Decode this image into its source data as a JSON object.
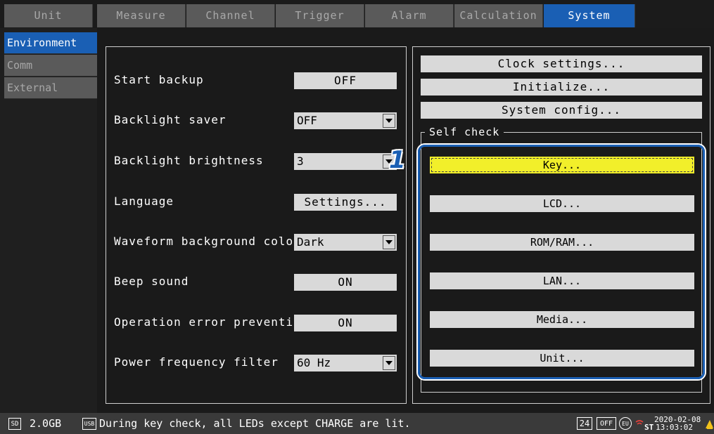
{
  "tabs": [
    "Unit",
    "Measure",
    "Channel",
    "Trigger",
    "Alarm",
    "Calculation",
    "System"
  ],
  "active_tab": "System",
  "left_menu": [
    "Environment",
    "Comm",
    "External"
  ],
  "settings": {
    "start_backup": {
      "label": "Start backup",
      "value": "OFF"
    },
    "backlight_saver": {
      "label": "Backlight saver",
      "value": "OFF"
    },
    "backlight_brightness": {
      "label": "Backlight brightness",
      "value": "3"
    },
    "language": {
      "label": "Language",
      "value": "Settings..."
    },
    "waveform_bg": {
      "label": "Waveform background color",
      "value": "Dark"
    },
    "beep": {
      "label": "Beep sound",
      "value": "ON"
    },
    "op_error": {
      "label": "Operation error prevention",
      "value": "ON"
    },
    "power_filter": {
      "label": "Power frequency filter",
      "value": "60 Hz"
    }
  },
  "system_buttons": {
    "clock": "Clock settings...",
    "initialize": "Initialize...",
    "config": "System config..."
  },
  "self_check": {
    "title": "Self check",
    "buttons": [
      "Key...",
      "LCD...",
      "ROM/RAM...",
      "LAN...",
      "Media...",
      "Unit..."
    ]
  },
  "step_marker": "1",
  "status": {
    "sd_icon": "SD",
    "capacity": "2.0GB",
    "usb_icon": "USB",
    "message": "During key check, all LEDs except CHARGE are lit.",
    "hours_badge": "24",
    "off_badge": "OFF",
    "eu_badge": "EU",
    "date": "2020-02-08",
    "time_prefix": "ST",
    "time": "13:03:02"
  },
  "colors": {
    "accent": "#1a5fb4",
    "focus": "#f2ef2a",
    "control": "#d9d9d9"
  }
}
